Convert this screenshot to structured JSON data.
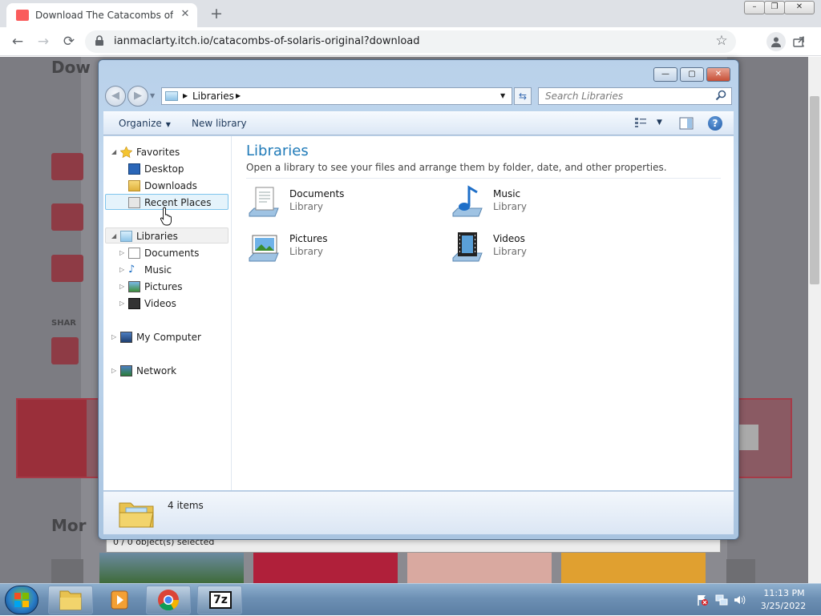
{
  "browser": {
    "tab_title": "Download The Catacombs of Solaris",
    "tab_close": "✕",
    "new_tab": "+",
    "url": "ianmaclarty.itch.io/catacombs-of-solaris-original?download",
    "back": "←",
    "forward": "→",
    "reload": "⟳",
    "star": "☆",
    "menu": "⋮",
    "win_minimize": "–",
    "win_restore": "❐",
    "win_close": "✕"
  },
  "background_page": {
    "heading": "Dow",
    "more_heading": "Mor",
    "share_label": "SHAR",
    "status_text": "0 / 0 object(s) selected"
  },
  "explorer": {
    "caption_minimize": "—",
    "caption_maximize": "▢",
    "caption_close": "✕",
    "address_path": "Libraries",
    "search_placeholder": "Search Libraries",
    "commands": {
      "organize": "Organize",
      "new_library": "New library"
    },
    "nav": {
      "favorites": "Favorites",
      "desktop": "Desktop",
      "downloads": "Downloads",
      "recent_places": "Recent Places",
      "libraries": "Libraries",
      "documents": "Documents",
      "music": "Music",
      "pictures": "Pictures",
      "videos": "Videos",
      "my_computer": "My Computer",
      "network": "Network"
    },
    "content": {
      "title": "Libraries",
      "description": "Open a library to see your files and arrange them by folder, date, and other properties.",
      "libraries": [
        {
          "name": "Documents",
          "type": "Library"
        },
        {
          "name": "Music",
          "type": "Library"
        },
        {
          "name": "Pictures",
          "type": "Library"
        },
        {
          "name": "Videos",
          "type": "Library"
        }
      ]
    },
    "details": {
      "item_count": "4 items"
    }
  },
  "taskbar": {
    "time": "11:13 PM",
    "date": "3/25/2022",
    "archive_label": "7z"
  },
  "colors": {
    "accent_title": "#1f7ab8",
    "chrome_tab_bg": "#dee1e6",
    "itch_red": "#fa5c5c"
  }
}
